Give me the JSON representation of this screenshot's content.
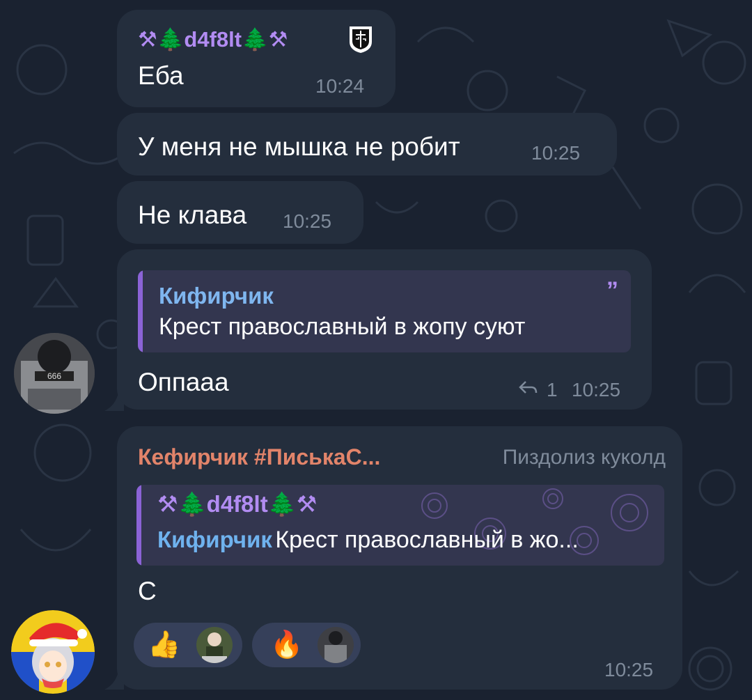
{
  "messages": {
    "m1": {
      "sender": "⚒🌲d4f8lt🌲⚒",
      "text": "Еба",
      "time": "10:24"
    },
    "m2": {
      "text": "У меня не мышка не робит",
      "time": "10:25"
    },
    "m3": {
      "text": "Не клава",
      "time": "10:25"
    },
    "m4": {
      "quote_author": "Кифирчик",
      "quote_text": "Крест православный в жопу суют",
      "text": "Оппааа",
      "reply_count": "1",
      "time": "10:25"
    },
    "m5": {
      "sender": "Кефирчик #ПиськаС...",
      "sender_title": "Пиздолиз куколд",
      "reply_author": "⚒🌲d4f8lt🌲⚒",
      "reply_quote_author": "Кифирчик",
      "reply_quote_text": "Крест православный в жо...",
      "text": "С",
      "time": "10:25",
      "reactions": [
        {
          "emoji": "👍"
        },
        {
          "emoji": "🔥"
        }
      ]
    }
  },
  "colors": {
    "background": "#1a2230",
    "bubble": "#242e3d",
    "sender": "#b28cf2",
    "quote_name": "#6fb2ee",
    "second_sender": "#e2846a",
    "time": "#7f8b9b"
  }
}
